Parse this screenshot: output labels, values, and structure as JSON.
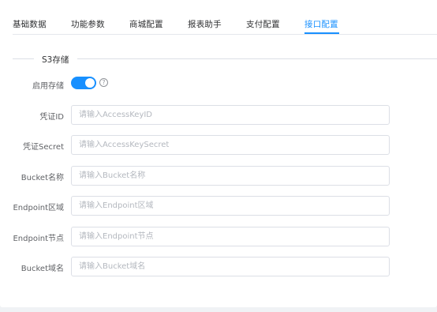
{
  "tabs": [
    {
      "label": "基础数据",
      "active": false
    },
    {
      "label": "功能参数",
      "active": false
    },
    {
      "label": "商城配置",
      "active": false
    },
    {
      "label": "报表助手",
      "active": false
    },
    {
      "label": "支付配置",
      "active": false
    },
    {
      "label": "接口配置",
      "active": true
    }
  ],
  "section": {
    "title": "S3存储"
  },
  "enable_storage": {
    "label": "启用存储",
    "on": true,
    "help_icon": "question-circle-icon"
  },
  "fields": [
    {
      "label": "凭证ID",
      "value": "",
      "placeholder": "请输入AccessKeyID"
    },
    {
      "label": "凭证Secret",
      "value": "",
      "placeholder": "请输入AccessKeySecret"
    },
    {
      "label": "Bucket名称",
      "value": "",
      "placeholder": "请输入Bucket名称"
    },
    {
      "label": "Endpoint区域",
      "value": "",
      "placeholder": "请输入Endpoint区域"
    },
    {
      "label": "Endpoint节点",
      "value": "",
      "placeholder": "请输入Endpoint节点"
    },
    {
      "label": "Bucket域名",
      "value": "",
      "placeholder": "请输入Bucket域名"
    }
  ],
  "colors": {
    "accent": "#1890ff",
    "border": "#dcdfe6",
    "text": "#606266",
    "placeholder": "#b4b8bf"
  }
}
